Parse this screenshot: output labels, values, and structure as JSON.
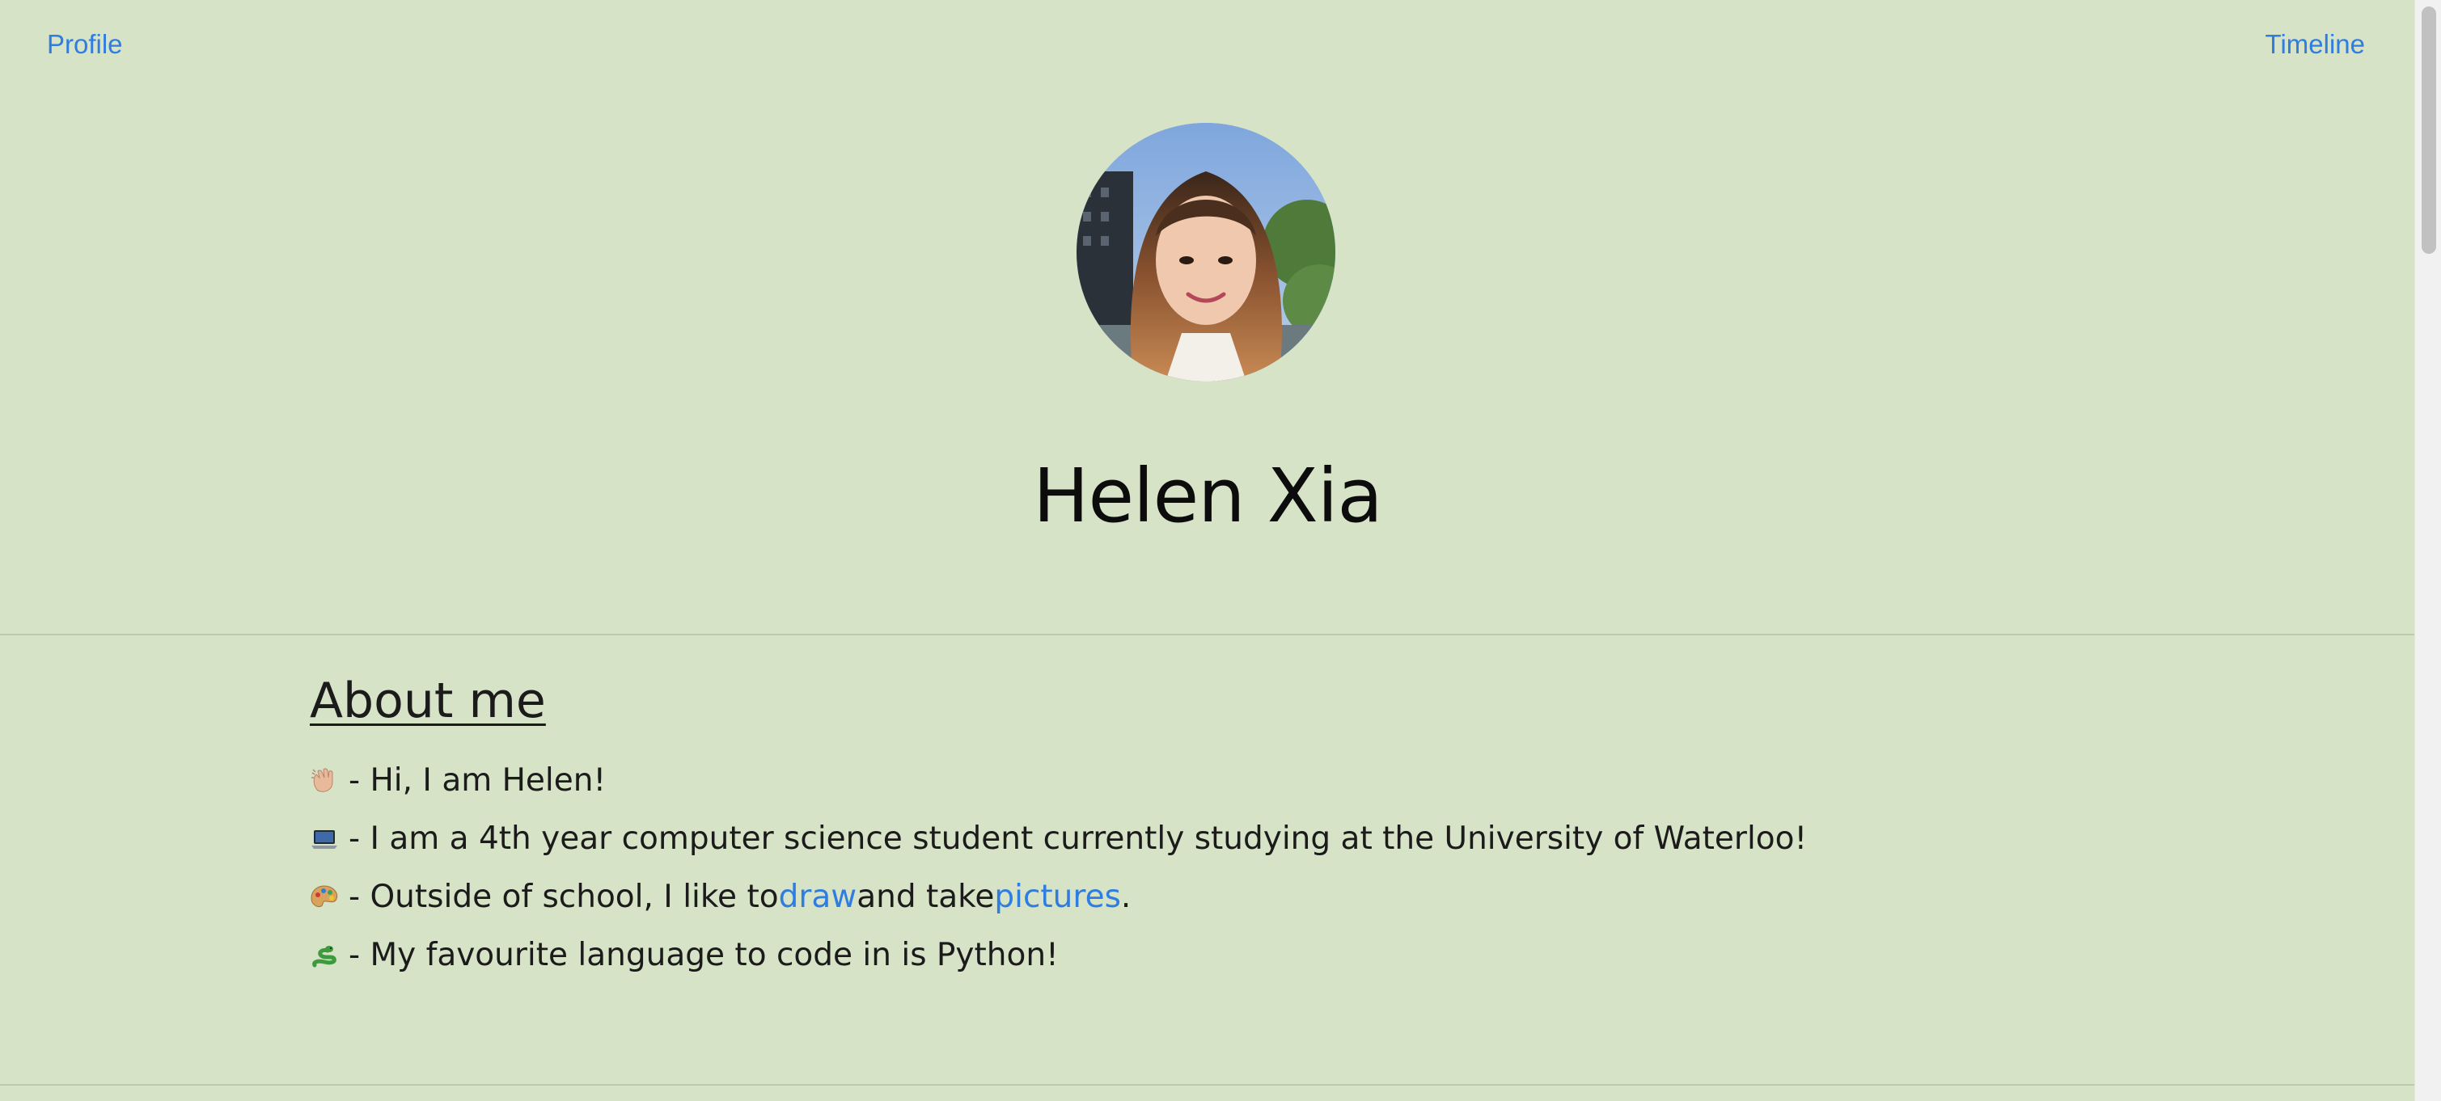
{
  "nav": {
    "profile_label": "Profile",
    "timeline_label": "Timeline"
  },
  "profile": {
    "name": "Helen Xia",
    "avatar_icon": "profile-photo"
  },
  "about": {
    "title": "About me",
    "lines": [
      {
        "emoji": "waving-hand-icon",
        "text": " - Hi, I am Helen!"
      },
      {
        "emoji": "laptop-icon",
        "text": " - I am a 4th year computer science student currently studying at the University of Waterloo!"
      },
      {
        "emoji": "artist-palette-icon",
        "text_before": " - Outside of school, I like to ",
        "link1": "draw",
        "text_middle": " and take ",
        "link2": "pictures",
        "text_after": "."
      },
      {
        "emoji": "snake-icon",
        "text": " - My favourite language to code in is Python!"
      }
    ]
  },
  "colors": {
    "background": "#d6e3c6",
    "link": "#2f7de1",
    "text": "#1b1b1b"
  }
}
